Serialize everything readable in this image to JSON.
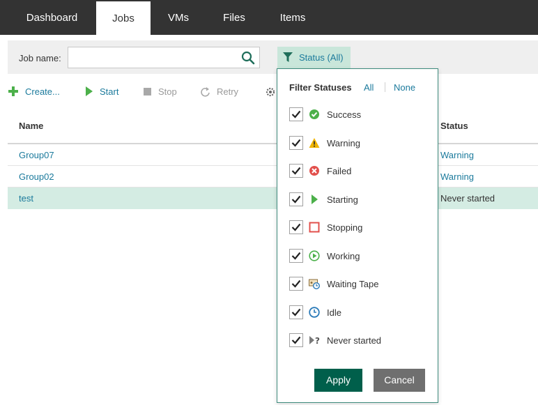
{
  "nav": {
    "tabs": [
      {
        "label": "Dashboard",
        "active": false
      },
      {
        "label": "Jobs",
        "active": true
      },
      {
        "label": "VMs",
        "active": false
      },
      {
        "label": "Files",
        "active": false
      },
      {
        "label": "Items",
        "active": false
      }
    ]
  },
  "search": {
    "label": "Job name:",
    "value": "",
    "placeholder": "",
    "icon": "search-icon"
  },
  "status_filter": {
    "label": "Status (All)",
    "icon": "filter-icon"
  },
  "toolbar": {
    "create_label": "Create...",
    "start_label": "Start",
    "stop_label": "Stop",
    "retry_label": "Retry"
  },
  "grid": {
    "columns": {
      "name": "Name",
      "status": "Status"
    },
    "rows": [
      {
        "name": "Group07",
        "status": "Warning",
        "selected": false
      },
      {
        "name": "Group02",
        "status": "Warning",
        "selected": false
      },
      {
        "name": "test",
        "status": "Never started",
        "selected": true
      }
    ]
  },
  "filter_panel": {
    "title": "Filter Statuses",
    "all_label": "All",
    "none_label": "None",
    "options": [
      {
        "label": "Success",
        "checked": true,
        "icon": "success-icon"
      },
      {
        "label": "Warning",
        "checked": true,
        "icon": "warning-icon"
      },
      {
        "label": "Failed",
        "checked": true,
        "icon": "failed-icon"
      },
      {
        "label": "Starting",
        "checked": true,
        "icon": "starting-icon"
      },
      {
        "label": "Stopping",
        "checked": true,
        "icon": "stopping-icon"
      },
      {
        "label": "Working",
        "checked": true,
        "icon": "working-icon"
      },
      {
        "label": "Waiting Tape",
        "checked": true,
        "icon": "waiting-tape-icon"
      },
      {
        "label": "Idle",
        "checked": true,
        "icon": "idle-icon"
      },
      {
        "label": "Never started",
        "checked": true,
        "icon": "never-started-icon"
      }
    ],
    "apply_label": "Apply",
    "cancel_label": "Cancel"
  },
  "colors": {
    "nav_bg": "#333333",
    "link": "#1b7a9c",
    "accent": "#005f4b",
    "selected_row": "#d4ece3",
    "success": "#4cb04a",
    "warning": "#f0b400",
    "failed": "#e2504c"
  }
}
